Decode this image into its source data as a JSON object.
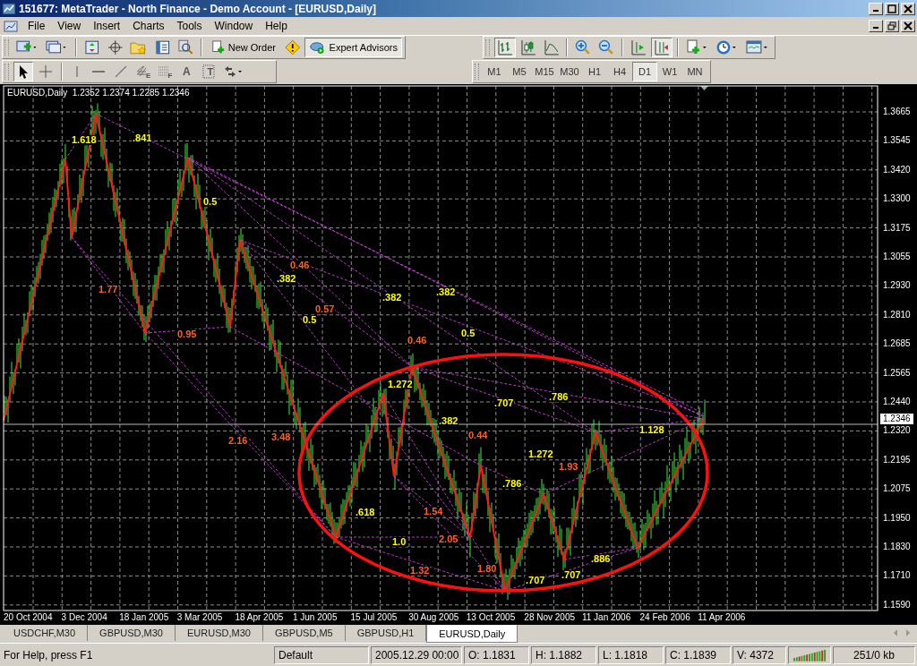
{
  "window": {
    "title": "151677: MetaTrader - North Finance - Demo Account - [EURUSD,Daily]"
  },
  "menu": [
    "File",
    "View",
    "Insert",
    "Charts",
    "Tools",
    "Window",
    "Help"
  ],
  "standard_toolbar": {
    "new_order": "New Order",
    "expert_advisors": {
      "label": "Expert Advisors",
      "selected": true
    }
  },
  "chart_tools": [
    {
      "kind": "bar-chart",
      "selected": true
    },
    {
      "kind": "candles",
      "selected": false
    },
    {
      "kind": "line-chart",
      "selected": false
    },
    {
      "kind": "zoom-in",
      "selected": false
    },
    {
      "kind": "zoom-out",
      "selected": false
    },
    {
      "kind": "autoscroll",
      "selected": false
    },
    {
      "kind": "chart-shift",
      "selected": true
    },
    {
      "kind": "indicators",
      "selected": false
    },
    {
      "kind": "periods",
      "selected": false
    },
    {
      "kind": "templates",
      "selected": false
    }
  ],
  "draw_tools": [
    {
      "kind": "cursor",
      "selected": true
    },
    {
      "kind": "crosshair",
      "selected": false
    },
    {
      "kind": "vertical-line",
      "selected": false
    },
    {
      "kind": "horizontal-line",
      "selected": false
    },
    {
      "kind": "trendline",
      "selected": false
    },
    {
      "kind": "fibo-e",
      "label": "E",
      "selected": false
    },
    {
      "kind": "fibo-f",
      "label": "F",
      "selected": false
    },
    {
      "kind": "text",
      "label": "A",
      "selected": false
    },
    {
      "kind": "text-label",
      "label": "T",
      "selected": false
    },
    {
      "kind": "arrows",
      "selected": false
    }
  ],
  "periods": [
    {
      "label": "M1",
      "selected": false
    },
    {
      "label": "M5",
      "selected": false
    },
    {
      "label": "M15",
      "selected": false
    },
    {
      "label": "M30",
      "selected": false
    },
    {
      "label": "H1",
      "selected": false
    },
    {
      "label": "H4",
      "selected": false
    },
    {
      "label": "D1",
      "selected": true
    },
    {
      "label": "W1",
      "selected": false
    },
    {
      "label": "MN",
      "selected": false
    }
  ],
  "chart": {
    "header": "EURUSD,Daily  1.2352 1.2374 1.2285 1.2346",
    "price_labels": [
      "1.3665",
      "1.3545",
      "1.3420",
      "1.3300",
      "1.3175",
      "1.3055",
      "1.2930",
      "1.2810",
      "1.2685",
      "1.2565",
      "1.2440",
      "1.2320",
      "1.2195",
      "1.2075",
      "1.1950",
      "1.1830",
      "1.1710",
      "1.1590"
    ],
    "current_price": "1.2346",
    "date_labels": [
      "20 Oct 2004",
      "3 Dec 2004",
      "18 Jan 2005",
      "3 Mar 2005",
      "18 Apr 2005",
      "1 Jun 2005",
      "15 Jul 2005",
      "30 Aug 2005",
      "13 Oct 2005",
      "28 Nov 2005",
      "11 Jan 2006",
      "24 Feb 2006",
      "11 Apr 2006"
    ],
    "ratio_labels": [
      {
        "text": "1.618",
        "color": "#ffff00"
      },
      {
        "text": ".841",
        "color": "#ffff00"
      },
      {
        "text": "0.5",
        "color": "#ffff00"
      },
      {
        "text": "1.77",
        "color": "#ff6020"
      },
      {
        "text": "0.95",
        "color": "#ff6020"
      },
      {
        "text": "0.46",
        "color": "#ff6020"
      },
      {
        "text": ".382",
        "color": "#ffff00"
      },
      {
        "text": ".382",
        "color": "#ffff00"
      },
      {
        "text": ".382",
        "color": "#ffff00"
      },
      {
        "text": "0.57",
        "color": "#ff6020"
      },
      {
        "text": "0.5",
        "color": "#ffff00"
      },
      {
        "text": "0.46",
        "color": "#ff6020"
      },
      {
        "text": "0.5",
        "color": "#ffff00"
      },
      {
        "text": "1.272",
        "color": "#ffff00"
      },
      {
        "text": ".707",
        "color": "#ffff00"
      },
      {
        "text": ".786",
        "color": "#ffff00"
      },
      {
        "text": ".382",
        "color": "#ffff00"
      },
      {
        "text": "0.44",
        "color": "#ff6020"
      },
      {
        "text": "3.48",
        "color": "#ff6020"
      },
      {
        "text": "2.16",
        "color": "#ff6020"
      },
      {
        "text": "1.128",
        "color": "#ffff00"
      },
      {
        "text": "1.272",
        "color": "#ffff00"
      },
      {
        "text": "1.93",
        "color": "#ff6020"
      },
      {
        "text": ".786",
        "color": "#ffff00"
      },
      {
        "text": ".618",
        "color": "#ffff00"
      },
      {
        "text": "1.54",
        "color": "#ff6020"
      },
      {
        "text": "1.0",
        "color": "#ffff00"
      },
      {
        "text": "2.05",
        "color": "#ff6020"
      },
      {
        "text": "1.32",
        "color": "#ff6020"
      },
      {
        "text": "1.80",
        "color": "#ff6020"
      },
      {
        "text": ".707",
        "color": "#ffff00"
      },
      {
        "text": ".707",
        "color": "#ffff00"
      },
      {
        "text": ".886",
        "color": "#ffff00"
      }
    ]
  },
  "tabs": [
    {
      "label": "USDCHF,M30",
      "selected": false
    },
    {
      "label": "GBPUSD,M30",
      "selected": false
    },
    {
      "label": "EURUSD,M30",
      "selected": false
    },
    {
      "label": "GBPUSD,M5",
      "selected": false
    },
    {
      "label": "GBPUSD,H1",
      "selected": false
    },
    {
      "label": "EURUSD,Daily",
      "selected": true
    }
  ],
  "status_bar": {
    "help": "For Help, press F1",
    "profile": "Default",
    "time": "2005.12.29 00:00",
    "open": "O: 1.1831",
    "high": "H: 1.1882",
    "low": "L: 1.1818",
    "close": "C: 1.1839",
    "volume": "V: 4372",
    "traffic": "251/0 kb"
  }
}
